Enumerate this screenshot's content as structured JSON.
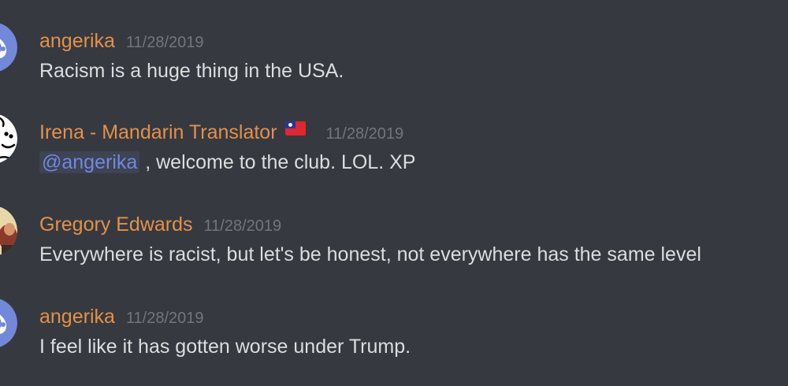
{
  "messages": [
    {
      "author": "angerika",
      "timestamp": "11/28/2019",
      "text": "Racism is a huge thing in the USA.",
      "avatar_icon": "discord-default-avatar-icon",
      "avatar_color": "#7289da"
    },
    {
      "author": "Irena - Mandarin Translator",
      "flag_icon": "taiwan-flag-icon",
      "timestamp": "11/28/2019",
      "mention": "@angerika",
      "text": " , welcome to the club. LOL. XP",
      "avatar_icon": "cartoon-face-avatar-icon"
    },
    {
      "author": "Gregory Edwards",
      "timestamp": "11/28/2019",
      "text": "Everywhere is racist, but let's be honest, not everywhere has the same level",
      "avatar_icon": "user-photo-avatar-icon"
    },
    {
      "author": "angerika",
      "timestamp": "11/28/2019",
      "text": "I feel like it has gotten worse under Trump.",
      "avatar_icon": "discord-default-avatar-icon",
      "avatar_color": "#7289da"
    }
  ],
  "colors": {
    "background": "#36393f",
    "username": "#e3914a",
    "timestamp": "#72767d",
    "message_text": "#dcddde",
    "mention": "#7289da"
  }
}
